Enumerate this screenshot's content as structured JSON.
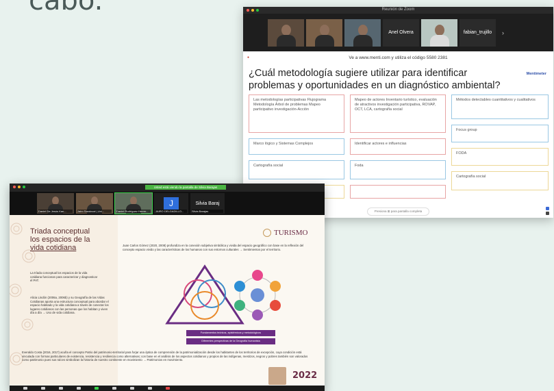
{
  "page": {
    "heading": "cabo."
  },
  "window1": {
    "title": "Reunión de Zoom",
    "participants": [
      {
        "name": "Anel Olvera"
      },
      {
        "name": "fabian_trujillo"
      }
    ],
    "join_text": "Ve a www.menti.com y utiliza el código 5580 2381",
    "brand": "Mentimeter",
    "question": "¿Cuál metodología sugiere utilizar para identificar problemas y oportunidades en un diagnóstico ambiental?",
    "options": [
      "Las metodologías participativas Flujograma Metodología Árbol de problemas Mapeo participativo investigación-Acción",
      "Mapeo de actores Inventario turístico, evaluación de atractivos investigación participativa, ROVAP, OCT, LCA, cartografía social",
      "Métodos detectables cuantitativos y cualitativos",
      "Marco lógico y Sistemas Complejos",
      "Identificar actores e influencias",
      "Focus group",
      "Cartografía social",
      "Foda",
      "FODA",
      "Cartografía social"
    ],
    "bottom_pill": "Presiona ⊞ para pantalla completa"
  },
  "window2": {
    "banner": "Usted está viendo la pantalla de Silvia Barajas",
    "participants": [
      {
        "name": "Daniel De Jesús Kan..."
      },
      {
        "name": "Jairo Sandoval | Uni..."
      },
      {
        "name": "Daniel Rodríguez Herrer..."
      },
      {
        "name": "JAIRO DELGADILLO..."
      },
      {
        "name": "Silvia Baraj",
        "sub": "Silvia Barajas"
      }
    ],
    "j_initial": "J",
    "slide": {
      "title_lines": [
        "Triada conceptual",
        "los espacios de la",
        "vida cotidiana"
      ],
      "turismo": "TURISMO",
      "intro_text": "Juan Carlos Gómez (2020, 2008) profundiza en la conexión subjetiva simbólica y vivida del espacio geográfico con base en la reflexión del concepto espacio vivido y las características de los humanos con sus entornos culturales → Sentimientos por el territorio.",
      "left_para1": "La tríada conceptual los espacios de la vida cotidiana funcionan para caracterizar y diagnosticar el PAT.",
      "left_para2": "Alicia Lindón (2006a, 2006b) y su Geografía de las Vidas Cotidianas aporta una estructura conceptual para abordar el espacio habitado y la vida cotidiana a través de conectar los lugares cotidianos con las personas que los habitan y viven día a día → Uso de vida cotidiana.",
      "box1": "Fundamentos teóricos, epistémicos y metodológicos",
      "box2": "Diferentes perspectivas de la Geografía humanista",
      "bottom_para": "Everaldo Costa (2016, 2017) acuña el concepto Patrio del patrimonio-territorial para forjar una óptica de comprensión de la patrimonialización desde los habitantes de los territorios de excepción, cuya condición está vinculada con formas particulares de existencia, resistencia y resiliencia como alternativas; con base en el análisis de los aspectos cotidianos y propios de las indígenas, mestizos, negros y pobres también son valorados como patrimonio pues sus raíces simbolizan la historia de nuestro continente en movimiento → Patrimonios en movimiento.",
      "year": "2022"
    }
  }
}
